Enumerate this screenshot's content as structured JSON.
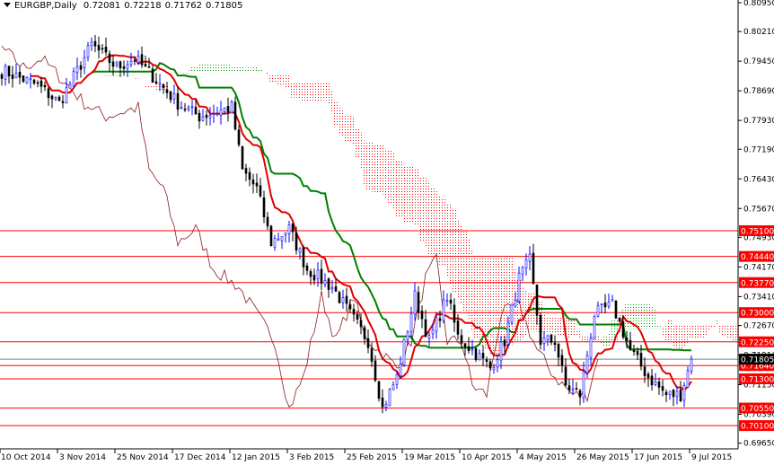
{
  "header": {
    "symbol": "EURGBP,Daily",
    "open": "0.72081",
    "high": "0.72218",
    "low": "0.71762",
    "close": "0.71805"
  },
  "colors": {
    "tenkan": "#e00000",
    "kijun": "#008000",
    "chikou": "#8b1a1a",
    "cloud_bear": "#ff0000",
    "cloud_bull": "#00a000",
    "candle_up": "#0000ff",
    "candle_down": "#000000",
    "level": "#ff0000",
    "level_label_bg": "#ff0000",
    "current_price_bg": "#000000"
  },
  "chart_data": {
    "type": "candlestick",
    "title": "EURGBP,Daily",
    "indicators": [
      "Ichimoku Kinko Hyo"
    ],
    "ylim": [
      0.695,
      0.81
    ],
    "y_ticks": [
      "0.80950",
      "0.80210",
      "0.79450",
      "0.78690",
      "0.77930",
      "0.77190",
      "0.76430",
      "0.75670",
      "0.74930",
      "0.74170",
      "0.73410",
      "0.72670",
      "0.71910",
      "0.71150",
      "0.70390",
      "0.69650"
    ],
    "x_ticks": [
      "10 Oct 2014",
      "3 Nov 2014",
      "25 Nov 2014",
      "17 Dec 2014",
      "12 Jan 2015",
      "3 Feb 2015",
      "25 Feb 2015",
      "19 Mar 2015",
      "10 Apr 2015",
      "4 May 2015",
      "26 May 2015",
      "17 Jun 2015",
      "9 Jul 2015"
    ],
    "x_tick_bar_index": [
      0,
      16,
      32,
      48,
      64,
      80,
      96,
      112,
      128,
      144,
      160,
      176,
      192
    ],
    "close_anchors": [
      {
        "bar": 1,
        "close": 0.7918
      },
      {
        "bar": 10,
        "close": 0.7883
      },
      {
        "bar": 16,
        "close": 0.7837
      },
      {
        "bar": 25,
        "close": 0.7987
      },
      {
        "bar": 32,
        "close": 0.7929
      },
      {
        "bar": 37,
        "close": 0.7952
      },
      {
        "bar": 42,
        "close": 0.7906
      },
      {
        "bar": 49,
        "close": 0.7837
      },
      {
        "bar": 55,
        "close": 0.7803
      },
      {
        "bar": 64,
        "close": 0.7826
      },
      {
        "bar": 67,
        "close": 0.7664
      },
      {
        "bar": 71,
        "close": 0.7618
      },
      {
        "bar": 75,
        "close": 0.748
      },
      {
        "bar": 80,
        "close": 0.7515
      },
      {
        "bar": 85,
        "close": 0.7411
      },
      {
        "bar": 92,
        "close": 0.7365
      },
      {
        "bar": 97,
        "close": 0.7296
      },
      {
        "bar": 102,
        "close": 0.7227
      },
      {
        "bar": 106,
        "close": 0.7054
      },
      {
        "bar": 110,
        "close": 0.7135
      },
      {
        "bar": 115,
        "close": 0.7342
      },
      {
        "bar": 119,
        "close": 0.7227
      },
      {
        "bar": 124,
        "close": 0.7342
      },
      {
        "bar": 127,
        "close": 0.7238
      },
      {
        "bar": 131,
        "close": 0.7204
      },
      {
        "bar": 136,
        "close": 0.7158
      },
      {
        "bar": 140,
        "close": 0.7227
      },
      {
        "bar": 144,
        "close": 0.7388
      },
      {
        "bar": 147,
        "close": 0.7434
      },
      {
        "bar": 150,
        "close": 0.7227
      },
      {
        "bar": 154,
        "close": 0.7227
      },
      {
        "bar": 157,
        "close": 0.7112
      },
      {
        "bar": 161,
        "close": 0.7089
      },
      {
        "bar": 165,
        "close": 0.7296
      },
      {
        "bar": 170,
        "close": 0.7319
      },
      {
        "bar": 175,
        "close": 0.7204
      },
      {
        "bar": 180,
        "close": 0.7135
      },
      {
        "bar": 185,
        "close": 0.7089
      },
      {
        "bar": 189,
        "close": 0.7089
      },
      {
        "bar": 192,
        "close": 0.71805
      }
    ],
    "horizontal_levels": [
      "0.75100",
      "0.74440",
      "0.73770",
      "0.73000",
      "0.72250",
      "0.71640",
      "0.71300",
      "0.70550",
      "0.70100"
    ],
    "current_price": "0.71805"
  }
}
